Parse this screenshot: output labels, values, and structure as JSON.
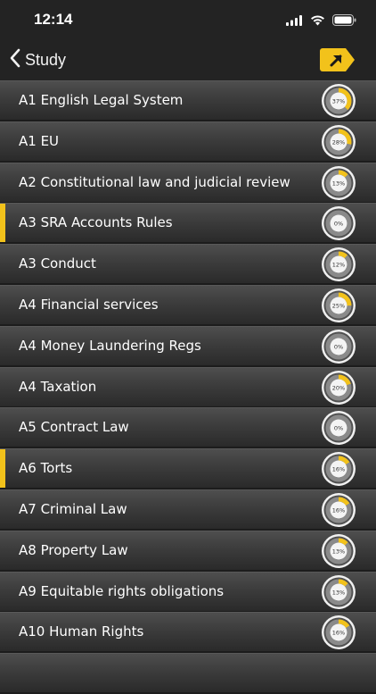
{
  "status": {
    "time": "12:14"
  },
  "nav": {
    "back_label": "Study",
    "tag_icon": "arrow-up-right-icon",
    "accent_color": "#f2c21b"
  },
  "topics": [
    {
      "label": "A1 English Legal System",
      "progress": "37%",
      "selected": false
    },
    {
      "label": "A1 EU",
      "progress": "28%",
      "selected": false
    },
    {
      "label": "A2 Constitutional law and judicial review",
      "progress": "13%",
      "selected": false
    },
    {
      "label": "A3 SRA Accounts Rules",
      "progress": "0%",
      "selected": true
    },
    {
      "label": "A3 Conduct",
      "progress": "12%",
      "selected": false
    },
    {
      "label": "A4 Financial services",
      "progress": "25%",
      "selected": false
    },
    {
      "label": "A4 Money Laundering Regs",
      "progress": "0%",
      "selected": false
    },
    {
      "label": "A4 Taxation",
      "progress": "20%",
      "selected": false
    },
    {
      "label": "A5 Contract Law",
      "progress": "0%",
      "selected": false
    },
    {
      "label": "A6 Torts",
      "progress": "16%",
      "selected": true
    },
    {
      "label": "A7 Criminal Law",
      "progress": "16%",
      "selected": false
    },
    {
      "label": "A8 Property Law",
      "progress": "13%",
      "selected": false
    },
    {
      "label": "A9 Equitable rights  obligations",
      "progress": "13%",
      "selected": false
    },
    {
      "label": "A10 Human Rights",
      "progress": "16%",
      "selected": false
    },
    {
      "label": "",
      "progress": "",
      "selected": false
    }
  ]
}
